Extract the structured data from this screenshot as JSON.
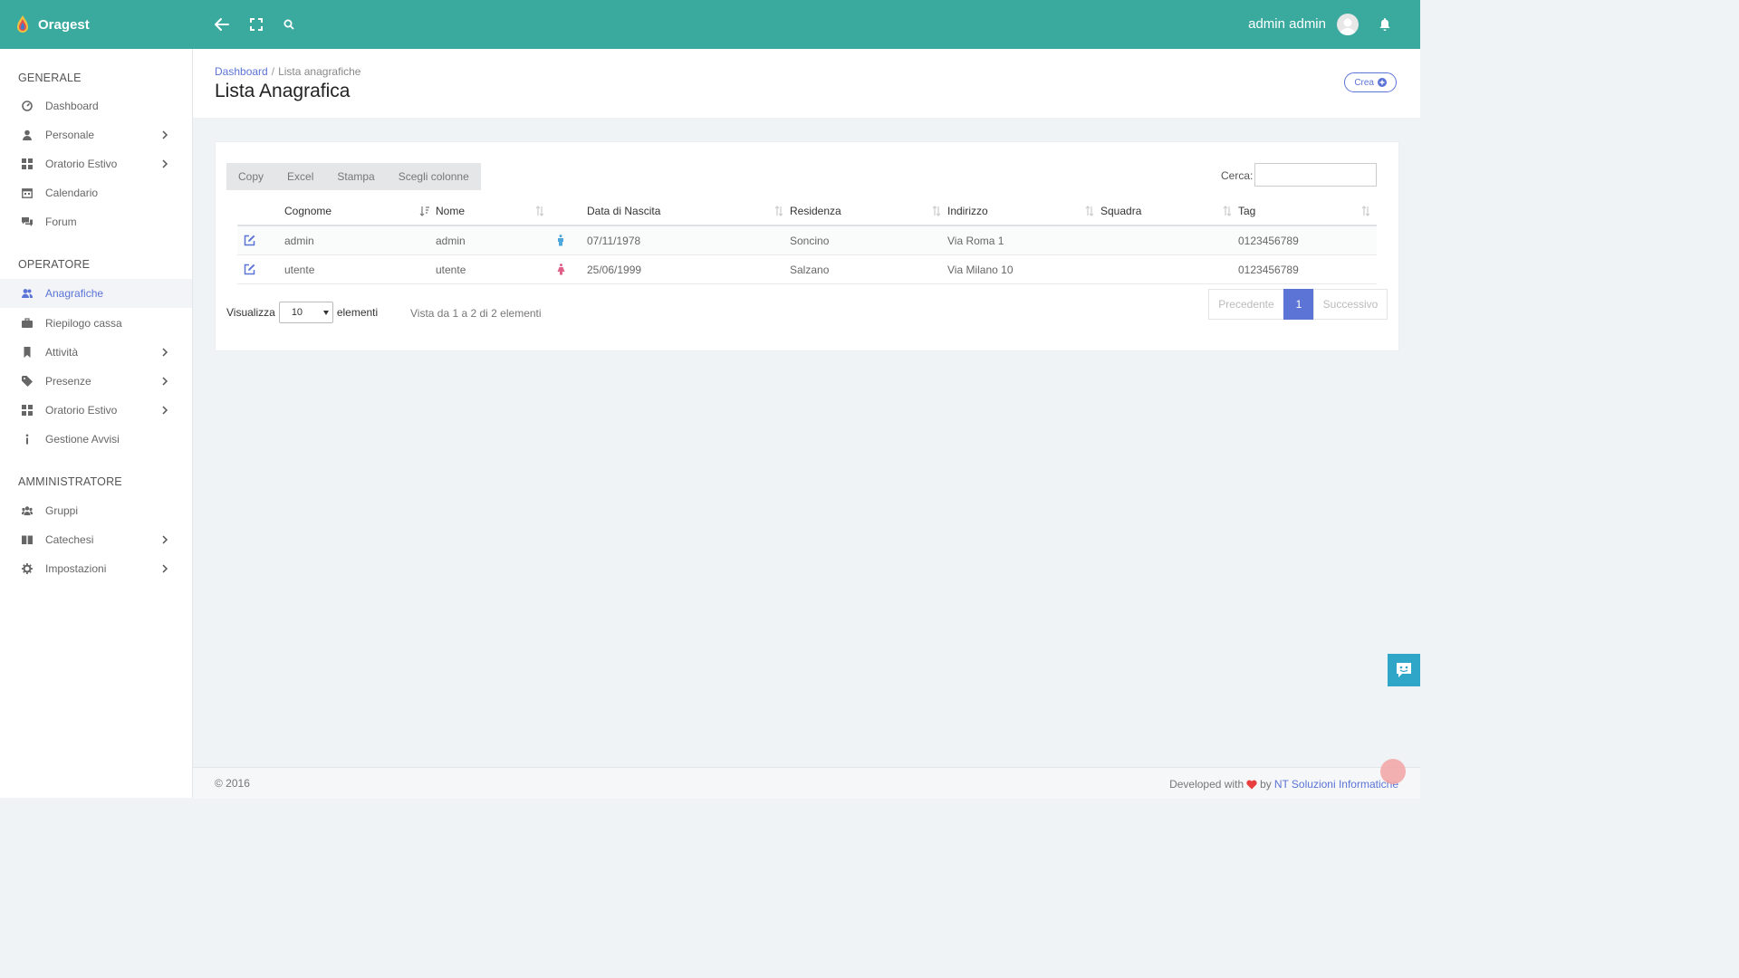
{
  "app": {
    "name": "Oragest",
    "user_name": "admin admin",
    "accent_color": "#3aaa9e",
    "primary_color": "#5b74d6"
  },
  "topbar": {
    "icons": [
      "back-arrow-icon",
      "fullscreen-icon",
      "search-icon",
      "bell-icon"
    ]
  },
  "sidebar": {
    "sections": [
      {
        "title": "GENERALE",
        "items": [
          {
            "label": "Dashboard",
            "icon": "dashboard-icon",
            "chevron": false
          },
          {
            "label": "Personale",
            "icon": "user-icon",
            "chevron": true
          },
          {
            "label": "Oratorio Estivo",
            "icon": "grid-icon",
            "chevron": true
          },
          {
            "label": "Calendario",
            "icon": "calendar-icon",
            "chevron": false
          },
          {
            "label": "Forum",
            "icon": "chat-icon",
            "chevron": false
          }
        ]
      },
      {
        "title": "OPERATORE",
        "items": [
          {
            "label": "Anagrafiche",
            "icon": "users-icon",
            "chevron": false,
            "active": true
          },
          {
            "label": "Riepilogo cassa",
            "icon": "briefcase-icon",
            "chevron": false
          },
          {
            "label": "Attività",
            "icon": "bookmark-icon",
            "chevron": true
          },
          {
            "label": "Presenze",
            "icon": "tag-icon",
            "chevron": true
          },
          {
            "label": "Oratorio Estivo",
            "icon": "grid-icon",
            "chevron": true
          },
          {
            "label": "Gestione Avvisi",
            "icon": "info-icon",
            "chevron": false
          }
        ]
      },
      {
        "title": "AMMINISTRATORE",
        "items": [
          {
            "label": "Gruppi",
            "icon": "group-icon",
            "chevron": false
          },
          {
            "label": "Catechesi",
            "icon": "book-icon",
            "chevron": true
          },
          {
            "label": "Impostazioni",
            "icon": "gear-icon",
            "chevron": true
          }
        ]
      }
    ]
  },
  "header": {
    "breadcrumb_home": "Dashboard",
    "breadcrumb_sep": "/",
    "breadcrumb_current": "Lista anagrafiche",
    "title": "Lista Anagrafica",
    "create_label": "Crea"
  },
  "table_tools": {
    "buttons": [
      "Copy",
      "Excel",
      "Stampa",
      "Scegli colonne"
    ],
    "search_label": "Cerca:",
    "search_value": ""
  },
  "table": {
    "columns": [
      "",
      "Cognome",
      "Nome",
      "",
      "Data di Nascita",
      "Residenza",
      "Indirizzo",
      "Squadra",
      "Tag"
    ],
    "rows": [
      {
        "cognome": "admin",
        "nome": "admin",
        "gender": "male",
        "nascita": "07/11/1978",
        "residenza": "Soncino",
        "indirizzo": "Via Roma 1",
        "squadra": "",
        "tag": "0123456789"
      },
      {
        "cognome": "utente",
        "nome": "utente",
        "gender": "female",
        "nascita": "25/06/1999",
        "residenza": "Salzano",
        "indirizzo": "Via Milano 10",
        "squadra": "",
        "tag": "0123456789"
      }
    ]
  },
  "table_footer": {
    "show_label": "Visualizza",
    "page_size": "10",
    "elements_label": "elementi",
    "info": "Vista da 1 a 2 di 2 elementi",
    "prev": "Precedente",
    "current_page": "1",
    "next": "Successivo"
  },
  "footer": {
    "copyright": "© 2016",
    "developed_with": "Developed with",
    "by": "by",
    "company": "NT Soluzioni Informatiche"
  }
}
